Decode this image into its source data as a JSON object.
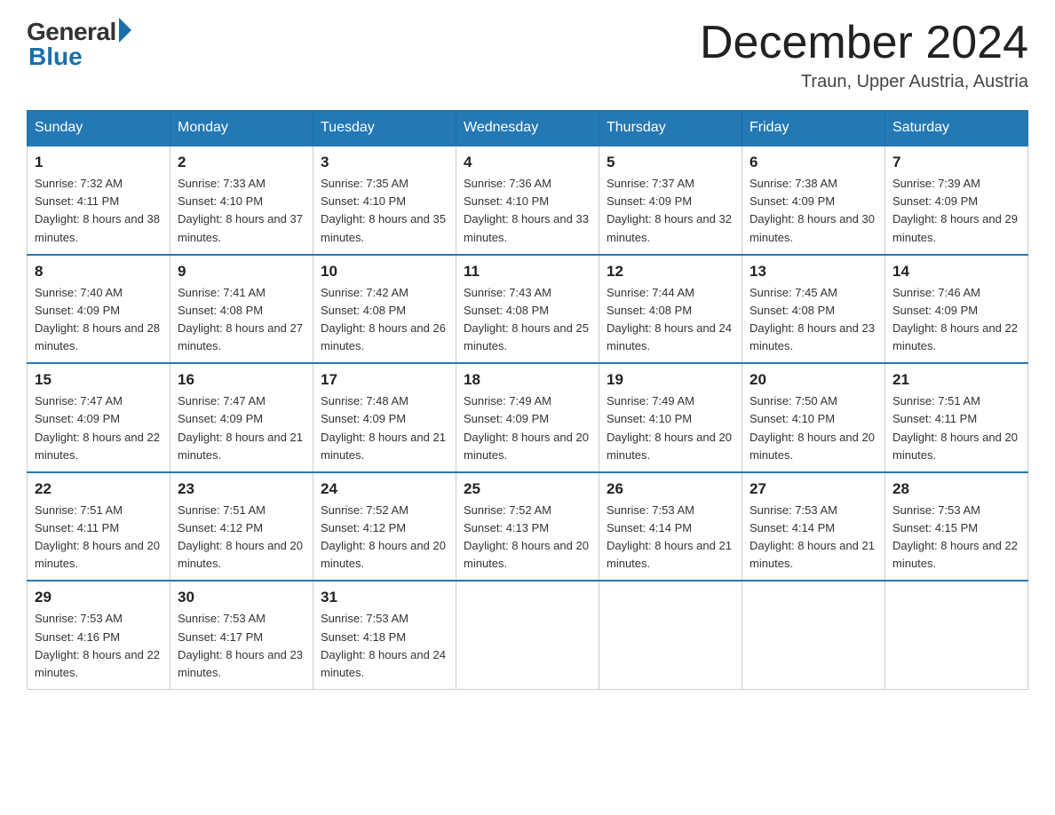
{
  "header": {
    "logo_general": "General",
    "logo_blue": "Blue",
    "month_title": "December 2024",
    "location": "Traun, Upper Austria, Austria"
  },
  "days_of_week": [
    "Sunday",
    "Monday",
    "Tuesday",
    "Wednesday",
    "Thursday",
    "Friday",
    "Saturday"
  ],
  "weeks": [
    [
      {
        "day": "1",
        "sunrise": "7:32 AM",
        "sunset": "4:11 PM",
        "daylight": "8 hours and 38 minutes."
      },
      {
        "day": "2",
        "sunrise": "7:33 AM",
        "sunset": "4:10 PM",
        "daylight": "8 hours and 37 minutes."
      },
      {
        "day": "3",
        "sunrise": "7:35 AM",
        "sunset": "4:10 PM",
        "daylight": "8 hours and 35 minutes."
      },
      {
        "day": "4",
        "sunrise": "7:36 AM",
        "sunset": "4:10 PM",
        "daylight": "8 hours and 33 minutes."
      },
      {
        "day": "5",
        "sunrise": "7:37 AM",
        "sunset": "4:09 PM",
        "daylight": "8 hours and 32 minutes."
      },
      {
        "day": "6",
        "sunrise": "7:38 AM",
        "sunset": "4:09 PM",
        "daylight": "8 hours and 30 minutes."
      },
      {
        "day": "7",
        "sunrise": "7:39 AM",
        "sunset": "4:09 PM",
        "daylight": "8 hours and 29 minutes."
      }
    ],
    [
      {
        "day": "8",
        "sunrise": "7:40 AM",
        "sunset": "4:09 PM",
        "daylight": "8 hours and 28 minutes."
      },
      {
        "day": "9",
        "sunrise": "7:41 AM",
        "sunset": "4:08 PM",
        "daylight": "8 hours and 27 minutes."
      },
      {
        "day": "10",
        "sunrise": "7:42 AM",
        "sunset": "4:08 PM",
        "daylight": "8 hours and 26 minutes."
      },
      {
        "day": "11",
        "sunrise": "7:43 AM",
        "sunset": "4:08 PM",
        "daylight": "8 hours and 25 minutes."
      },
      {
        "day": "12",
        "sunrise": "7:44 AM",
        "sunset": "4:08 PM",
        "daylight": "8 hours and 24 minutes."
      },
      {
        "day": "13",
        "sunrise": "7:45 AM",
        "sunset": "4:08 PM",
        "daylight": "8 hours and 23 minutes."
      },
      {
        "day": "14",
        "sunrise": "7:46 AM",
        "sunset": "4:09 PM",
        "daylight": "8 hours and 22 minutes."
      }
    ],
    [
      {
        "day": "15",
        "sunrise": "7:47 AM",
        "sunset": "4:09 PM",
        "daylight": "8 hours and 22 minutes."
      },
      {
        "day": "16",
        "sunrise": "7:47 AM",
        "sunset": "4:09 PM",
        "daylight": "8 hours and 21 minutes."
      },
      {
        "day": "17",
        "sunrise": "7:48 AM",
        "sunset": "4:09 PM",
        "daylight": "8 hours and 21 minutes."
      },
      {
        "day": "18",
        "sunrise": "7:49 AM",
        "sunset": "4:09 PM",
        "daylight": "8 hours and 20 minutes."
      },
      {
        "day": "19",
        "sunrise": "7:49 AM",
        "sunset": "4:10 PM",
        "daylight": "8 hours and 20 minutes."
      },
      {
        "day": "20",
        "sunrise": "7:50 AM",
        "sunset": "4:10 PM",
        "daylight": "8 hours and 20 minutes."
      },
      {
        "day": "21",
        "sunrise": "7:51 AM",
        "sunset": "4:11 PM",
        "daylight": "8 hours and 20 minutes."
      }
    ],
    [
      {
        "day": "22",
        "sunrise": "7:51 AM",
        "sunset": "4:11 PM",
        "daylight": "8 hours and 20 minutes."
      },
      {
        "day": "23",
        "sunrise": "7:51 AM",
        "sunset": "4:12 PM",
        "daylight": "8 hours and 20 minutes."
      },
      {
        "day": "24",
        "sunrise": "7:52 AM",
        "sunset": "4:12 PM",
        "daylight": "8 hours and 20 minutes."
      },
      {
        "day": "25",
        "sunrise": "7:52 AM",
        "sunset": "4:13 PM",
        "daylight": "8 hours and 20 minutes."
      },
      {
        "day": "26",
        "sunrise": "7:53 AM",
        "sunset": "4:14 PM",
        "daylight": "8 hours and 21 minutes."
      },
      {
        "day": "27",
        "sunrise": "7:53 AM",
        "sunset": "4:14 PM",
        "daylight": "8 hours and 21 minutes."
      },
      {
        "day": "28",
        "sunrise": "7:53 AM",
        "sunset": "4:15 PM",
        "daylight": "8 hours and 22 minutes."
      }
    ],
    [
      {
        "day": "29",
        "sunrise": "7:53 AM",
        "sunset": "4:16 PM",
        "daylight": "8 hours and 22 minutes."
      },
      {
        "day": "30",
        "sunrise": "7:53 AM",
        "sunset": "4:17 PM",
        "daylight": "8 hours and 23 minutes."
      },
      {
        "day": "31",
        "sunrise": "7:53 AM",
        "sunset": "4:18 PM",
        "daylight": "8 hours and 24 minutes."
      },
      null,
      null,
      null,
      null
    ]
  ]
}
